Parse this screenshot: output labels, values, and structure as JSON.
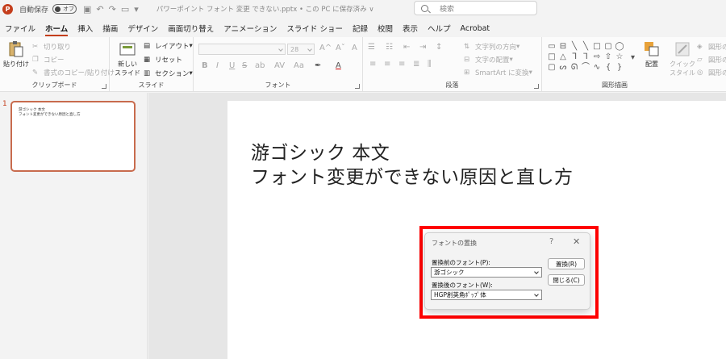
{
  "titlebar": {
    "autosave_label": "自動保存",
    "autosave_state": "オフ",
    "doc_title": "パワーポイント フォント 変更 できない.pptx • この PC に保存済み ∨",
    "search_placeholder": "検索"
  },
  "tabs": [
    "ファイル",
    "ホーム",
    "挿入",
    "描画",
    "デザイン",
    "画面切り替え",
    "アニメーション",
    "スライド ショー",
    "記録",
    "校閲",
    "表示",
    "ヘルプ",
    "Acrobat"
  ],
  "ribbon": {
    "clipboard": {
      "label": "クリップボード",
      "paste": "貼り付け",
      "cut": "切り取り",
      "copy": "コピー",
      "format_painter": "書式のコピー/貼り付け"
    },
    "slides": {
      "label": "スライド",
      "new_slide_1": "新しい",
      "new_slide_2": "スライド",
      "layout": "レイアウト",
      "reset": "リセット",
      "section": "セクション"
    },
    "font": {
      "label": "フォント",
      "font_size": "28",
      "bold": "B",
      "italic": "I",
      "underline": "U",
      "strike": "S",
      "shadow": "ab"
    },
    "paragraph": {
      "label": "段落",
      "text_direction": "文字列の方向",
      "align_text": "文字の配置",
      "smartart": "SmartArt に変換"
    },
    "drawing": {
      "label": "図形描画",
      "arrange": "配置",
      "quick_style_1": "クイック",
      "quick_style_2": "スタイル",
      "shape_fill": "図形の",
      "shape_outline": "図形の",
      "shape_effects": "図形の"
    }
  },
  "slide_panel": {
    "slide_number": "1",
    "thumb_line1": "游ゴシック 本文",
    "thumb_line2": "フォント変更ができない原因と直し方"
  },
  "slide": {
    "line1": "游ゴシック 本文",
    "line2": "フォント変更ができない原因と直し方"
  },
  "dialog": {
    "title": "フォントの置換",
    "help": "?",
    "close": "✕",
    "before_label": "置換前のフォント(P):",
    "before_value": "游ゴシック",
    "after_label": "置換後のフォント(W):",
    "after_value": "HGP創英角ﾎﾟｯﾌﾟ体",
    "replace_button": "置換(R)",
    "close_button": "閉じる(C)"
  },
  "colors": {
    "accent": "#c43e1c",
    "highlight": "#ff0000"
  }
}
